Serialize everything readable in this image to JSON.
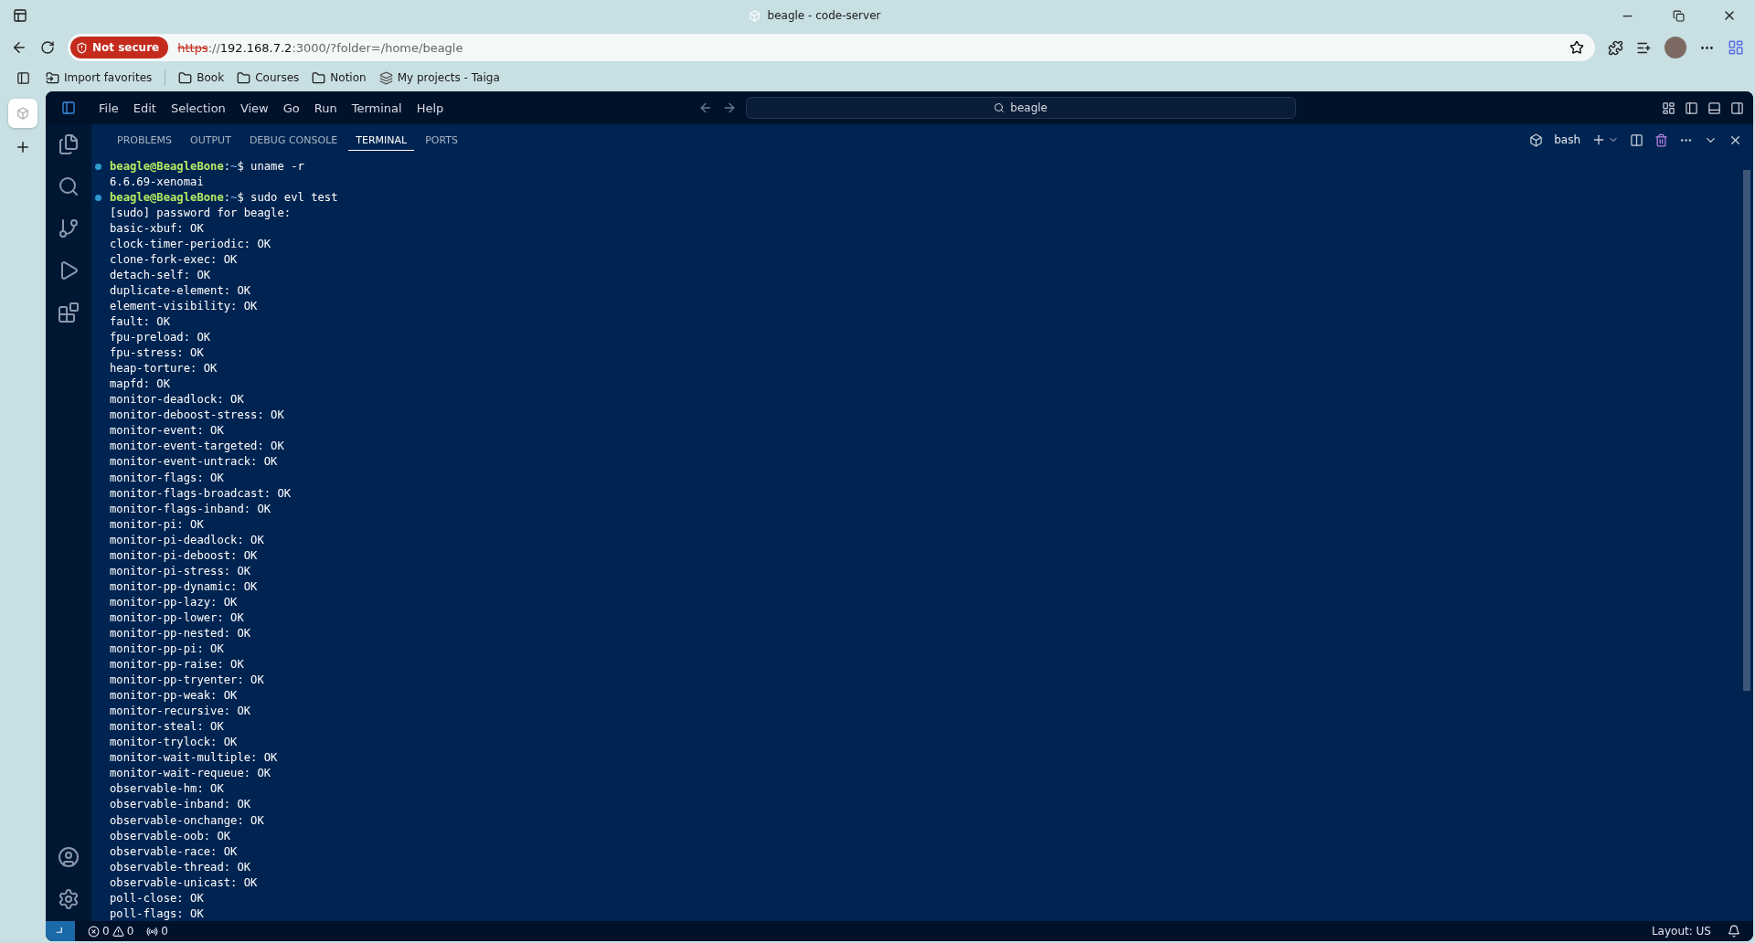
{
  "browser": {
    "tab_title": "beagle - code-server",
    "not_secure_label": "Not secure",
    "url": {
      "scheme": "https",
      "separator": "://",
      "host": "192.168.7.2",
      "rest": ":3000/?folder=/home/beagle"
    },
    "favorites": [
      {
        "kind": "import",
        "label": "Import favorites"
      },
      {
        "kind": "folder",
        "label": "Book"
      },
      {
        "kind": "folder",
        "label": "Courses"
      },
      {
        "kind": "folder",
        "label": "Notion"
      },
      {
        "kind": "site",
        "label": "My projects - Taiga"
      }
    ]
  },
  "menu": [
    "File",
    "Edit",
    "Selection",
    "View",
    "Go",
    "Run",
    "Terminal",
    "Help"
  ],
  "command_center": {
    "text": "beagle"
  },
  "panel_tabs": [
    {
      "label": "PROBLEMS",
      "selected": false
    },
    {
      "label": "OUTPUT",
      "selected": false
    },
    {
      "label": "DEBUG CONSOLE",
      "selected": false
    },
    {
      "label": "TERMINAL",
      "selected": true
    },
    {
      "label": "PORTS",
      "selected": false
    }
  ],
  "terminal_name": "bash",
  "terminal_lines": [
    {
      "kind": "prompt",
      "user": "beagle@BeagleBone",
      "sep": ":",
      "path": "~",
      "command": "$ uname -r"
    },
    {
      "kind": "output",
      "text": "6.6.69-xenomai"
    },
    {
      "kind": "prompt",
      "user": "beagle@BeagleBone",
      "sep": ":",
      "path": "~",
      "command": "$ sudo evl test"
    },
    {
      "kind": "output",
      "text": "[sudo] password for beagle:"
    },
    {
      "kind": "output",
      "text": "basic-xbuf: OK"
    },
    {
      "kind": "output",
      "text": "clock-timer-periodic: OK"
    },
    {
      "kind": "output",
      "text": "clone-fork-exec: OK"
    },
    {
      "kind": "output",
      "text": "detach-self: OK"
    },
    {
      "kind": "output",
      "text": "duplicate-element: OK"
    },
    {
      "kind": "output",
      "text": "element-visibility: OK"
    },
    {
      "kind": "output",
      "text": "fault: OK"
    },
    {
      "kind": "output",
      "text": "fpu-preload: OK"
    },
    {
      "kind": "output",
      "text": "fpu-stress: OK"
    },
    {
      "kind": "output",
      "text": "heap-torture: OK"
    },
    {
      "kind": "output",
      "text": "mapfd: OK"
    },
    {
      "kind": "output",
      "text": "monitor-deadlock: OK"
    },
    {
      "kind": "output",
      "text": "monitor-deboost-stress: OK"
    },
    {
      "kind": "output",
      "text": "monitor-event: OK"
    },
    {
      "kind": "output",
      "text": "monitor-event-targeted: OK"
    },
    {
      "kind": "output",
      "text": "monitor-event-untrack: OK"
    },
    {
      "kind": "output",
      "text": "monitor-flags: OK"
    },
    {
      "kind": "output",
      "text": "monitor-flags-broadcast: OK"
    },
    {
      "kind": "output",
      "text": "monitor-flags-inband: OK"
    },
    {
      "kind": "output",
      "text": "monitor-pi: OK"
    },
    {
      "kind": "output",
      "text": "monitor-pi-deadlock: OK"
    },
    {
      "kind": "output",
      "text": "monitor-pi-deboost: OK"
    },
    {
      "kind": "output",
      "text": "monitor-pi-stress: OK"
    },
    {
      "kind": "output",
      "text": "monitor-pp-dynamic: OK"
    },
    {
      "kind": "output",
      "text": "monitor-pp-lazy: OK"
    },
    {
      "kind": "output",
      "text": "monitor-pp-lower: OK"
    },
    {
      "kind": "output",
      "text": "monitor-pp-nested: OK"
    },
    {
      "kind": "output",
      "text": "monitor-pp-pi: OK"
    },
    {
      "kind": "output",
      "text": "monitor-pp-raise: OK"
    },
    {
      "kind": "output",
      "text": "monitor-pp-tryenter: OK"
    },
    {
      "kind": "output",
      "text": "monitor-pp-weak: OK"
    },
    {
      "kind": "output",
      "text": "monitor-recursive: OK"
    },
    {
      "kind": "output",
      "text": "monitor-steal: OK"
    },
    {
      "kind": "output",
      "text": "monitor-trylock: OK"
    },
    {
      "kind": "output",
      "text": "monitor-wait-multiple: OK"
    },
    {
      "kind": "output",
      "text": "monitor-wait-requeue: OK"
    },
    {
      "kind": "output",
      "text": "observable-hm: OK"
    },
    {
      "kind": "output",
      "text": "observable-inband: OK"
    },
    {
      "kind": "output",
      "text": "observable-onchange: OK"
    },
    {
      "kind": "output",
      "text": "observable-oob: OK"
    },
    {
      "kind": "output",
      "text": "observable-race: OK"
    },
    {
      "kind": "output",
      "text": "observable-thread: OK"
    },
    {
      "kind": "output",
      "text": "observable-unicast: OK"
    },
    {
      "kind": "output",
      "text": "poll-close: OK"
    },
    {
      "kind": "output",
      "text": "poll-flags: OK"
    }
  ],
  "status_bar": {
    "errors": "0",
    "warnings": "0",
    "ports": "0",
    "layout": "Layout: US"
  }
}
